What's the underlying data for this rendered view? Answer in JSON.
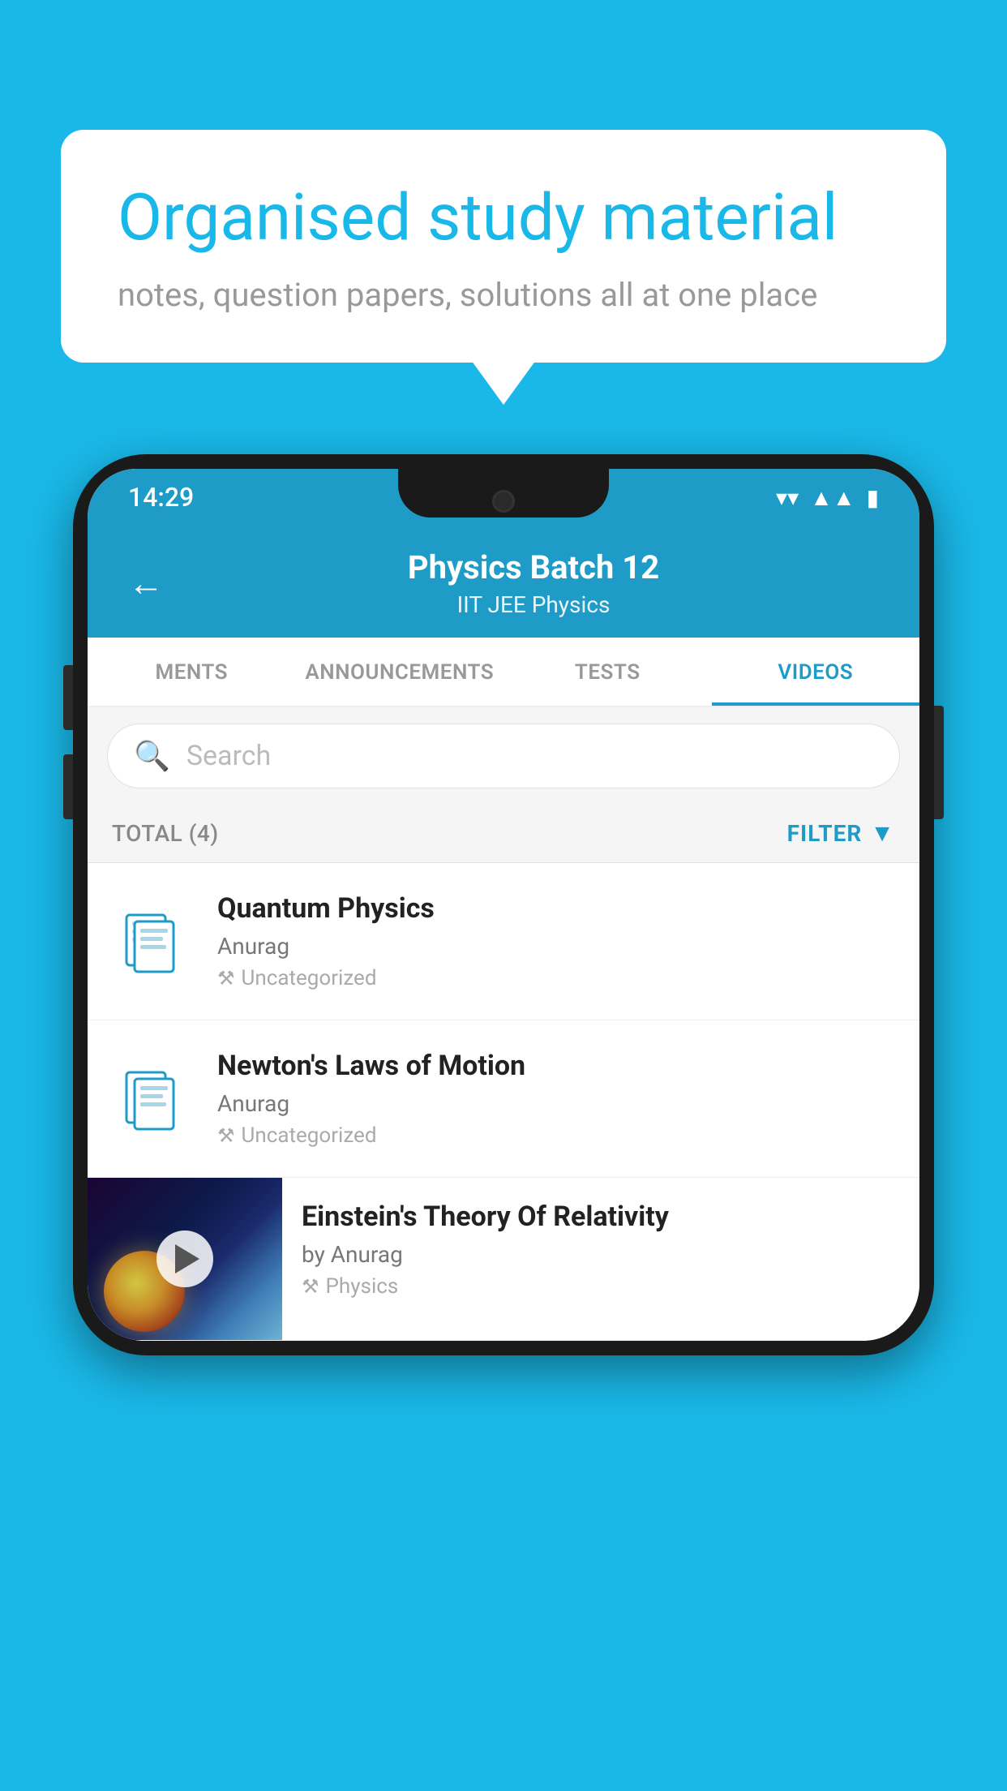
{
  "background_color": "#1ab8e8",
  "bubble": {
    "title": "Organised study material",
    "subtitle": "notes, question papers, solutions all at one place"
  },
  "phone": {
    "status_bar": {
      "time": "14:29"
    },
    "header": {
      "title": "Physics Batch 12",
      "subtitle": "IIT JEE   Physics",
      "back_label": "←"
    },
    "tabs": [
      {
        "label": "MENTS",
        "active": false
      },
      {
        "label": "ANNOUNCEMENTS",
        "active": false
      },
      {
        "label": "TESTS",
        "active": false
      },
      {
        "label": "VIDEOS",
        "active": true
      }
    ],
    "search": {
      "placeholder": "Search"
    },
    "filter": {
      "total_label": "TOTAL (4)",
      "filter_label": "FILTER"
    },
    "videos": [
      {
        "title": "Quantum Physics",
        "author": "Anurag",
        "tag": "Uncategorized",
        "type": "file"
      },
      {
        "title": "Newton's Laws of Motion",
        "author": "Anurag",
        "tag": "Uncategorized",
        "type": "file"
      },
      {
        "title": "Einstein's Theory Of Relativity",
        "author": "by Anurag",
        "tag": "Physics",
        "type": "thumb"
      }
    ]
  }
}
